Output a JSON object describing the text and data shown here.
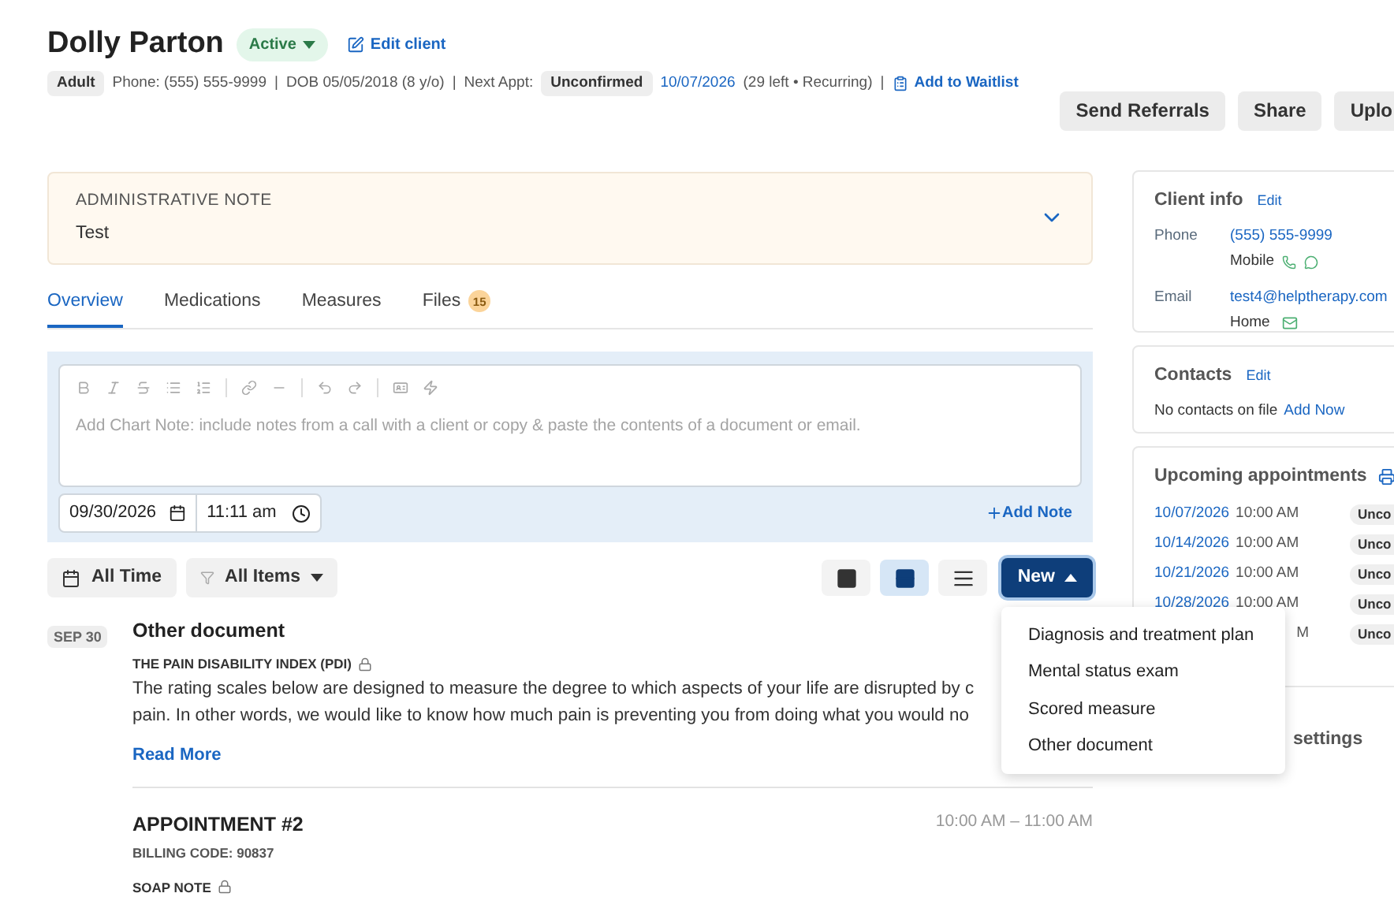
{
  "client": {
    "name": "Dolly Parton",
    "status": "Active",
    "edit_label": "Edit client",
    "age_group": "Adult",
    "phone": "Phone: (555) 555-9999",
    "dob": "DOB 05/05/2018 (8 y/o)",
    "next_appt_label": "Next Appt:",
    "next_appt_status": "Unconfirmed",
    "next_appt_date": "10/07/2026",
    "next_appt_detail": "(29 left • Recurring)",
    "waitlist_label": "Add to Waitlist",
    "separator": "|"
  },
  "actions": [
    "Send Referrals",
    "Share",
    "Uplo"
  ],
  "admin_note": {
    "title": "ADMINISTRATIVE NOTE",
    "text": "Test",
    "expanded": false
  },
  "tabs": [
    {
      "label": "Overview",
      "selected": true
    },
    {
      "label": "Medications",
      "selected": false
    },
    {
      "label": "Measures",
      "selected": false
    },
    {
      "label": "Files",
      "selected": false,
      "count": "15"
    }
  ],
  "chart_note": {
    "placeholder": "Add Chart Note: include notes from a call with a client or copy & paste the contents of a document or email.",
    "date": "09/30/2026",
    "time": "11:11 am",
    "add_label": "Add Note"
  },
  "filters": [
    "All Time",
    "All Items"
  ],
  "view_options": [
    {
      "kind": "card",
      "selected": false
    },
    {
      "kind": "compact",
      "selected": true
    },
    {
      "kind": "list",
      "selected": false
    }
  ],
  "new_button": {
    "label": "New",
    "expanded": true
  },
  "new_menu": [
    "Diagnosis and treatment plan",
    "Mental status exam",
    "Scored measure",
    "Other document"
  ],
  "timeline": [
    {
      "kind": "document",
      "date": "SEP 30",
      "title": "Other document",
      "subtitle": "THE PAIN DISABILITY INDEX (PDI)",
      "locked": true,
      "lines": [
        "The rating scales below are designed to measure the degree to which aspects of your life are disrupted by c",
        "pain. In other words, we would like to know how much pain is preventing you from doing what you would no"
      ],
      "more": "Read More"
    },
    {
      "kind": "appointment",
      "title": "APPOINTMENT #2",
      "time": "10:00 AM – 11:00 AM",
      "billing": "BILLING CODE: 90837",
      "note": "SOAP NOTE",
      "locked": true
    }
  ],
  "client_info": {
    "title": "Client info",
    "edit": "Edit",
    "phone_label": "Phone",
    "phone": "(555) 555-9999",
    "phone_type": "Mobile",
    "email_label": "Email",
    "email": "test4@helptherapy.com",
    "email_type": "Home"
  },
  "contacts": {
    "title": "Contacts",
    "edit": "Edit",
    "empty": "No contacts on file",
    "add": "Add Now"
  },
  "appointments": {
    "title": "Upcoming appointments",
    "items": [
      {
        "date": "10/07/2026",
        "time": "10:00 AM",
        "status": "Unco"
      },
      {
        "date": "10/14/2026",
        "time": "10:00 AM",
        "status": "Unco"
      },
      {
        "date": "10/21/2026",
        "time": "10:00 AM",
        "status": "Unco"
      },
      {
        "date": "10/28/2026",
        "time": "10:00 AM",
        "status": "Unco"
      },
      {
        "time": "M",
        "status": "Unco"
      }
    ]
  },
  "settings_card": {
    "title": "settings"
  }
}
